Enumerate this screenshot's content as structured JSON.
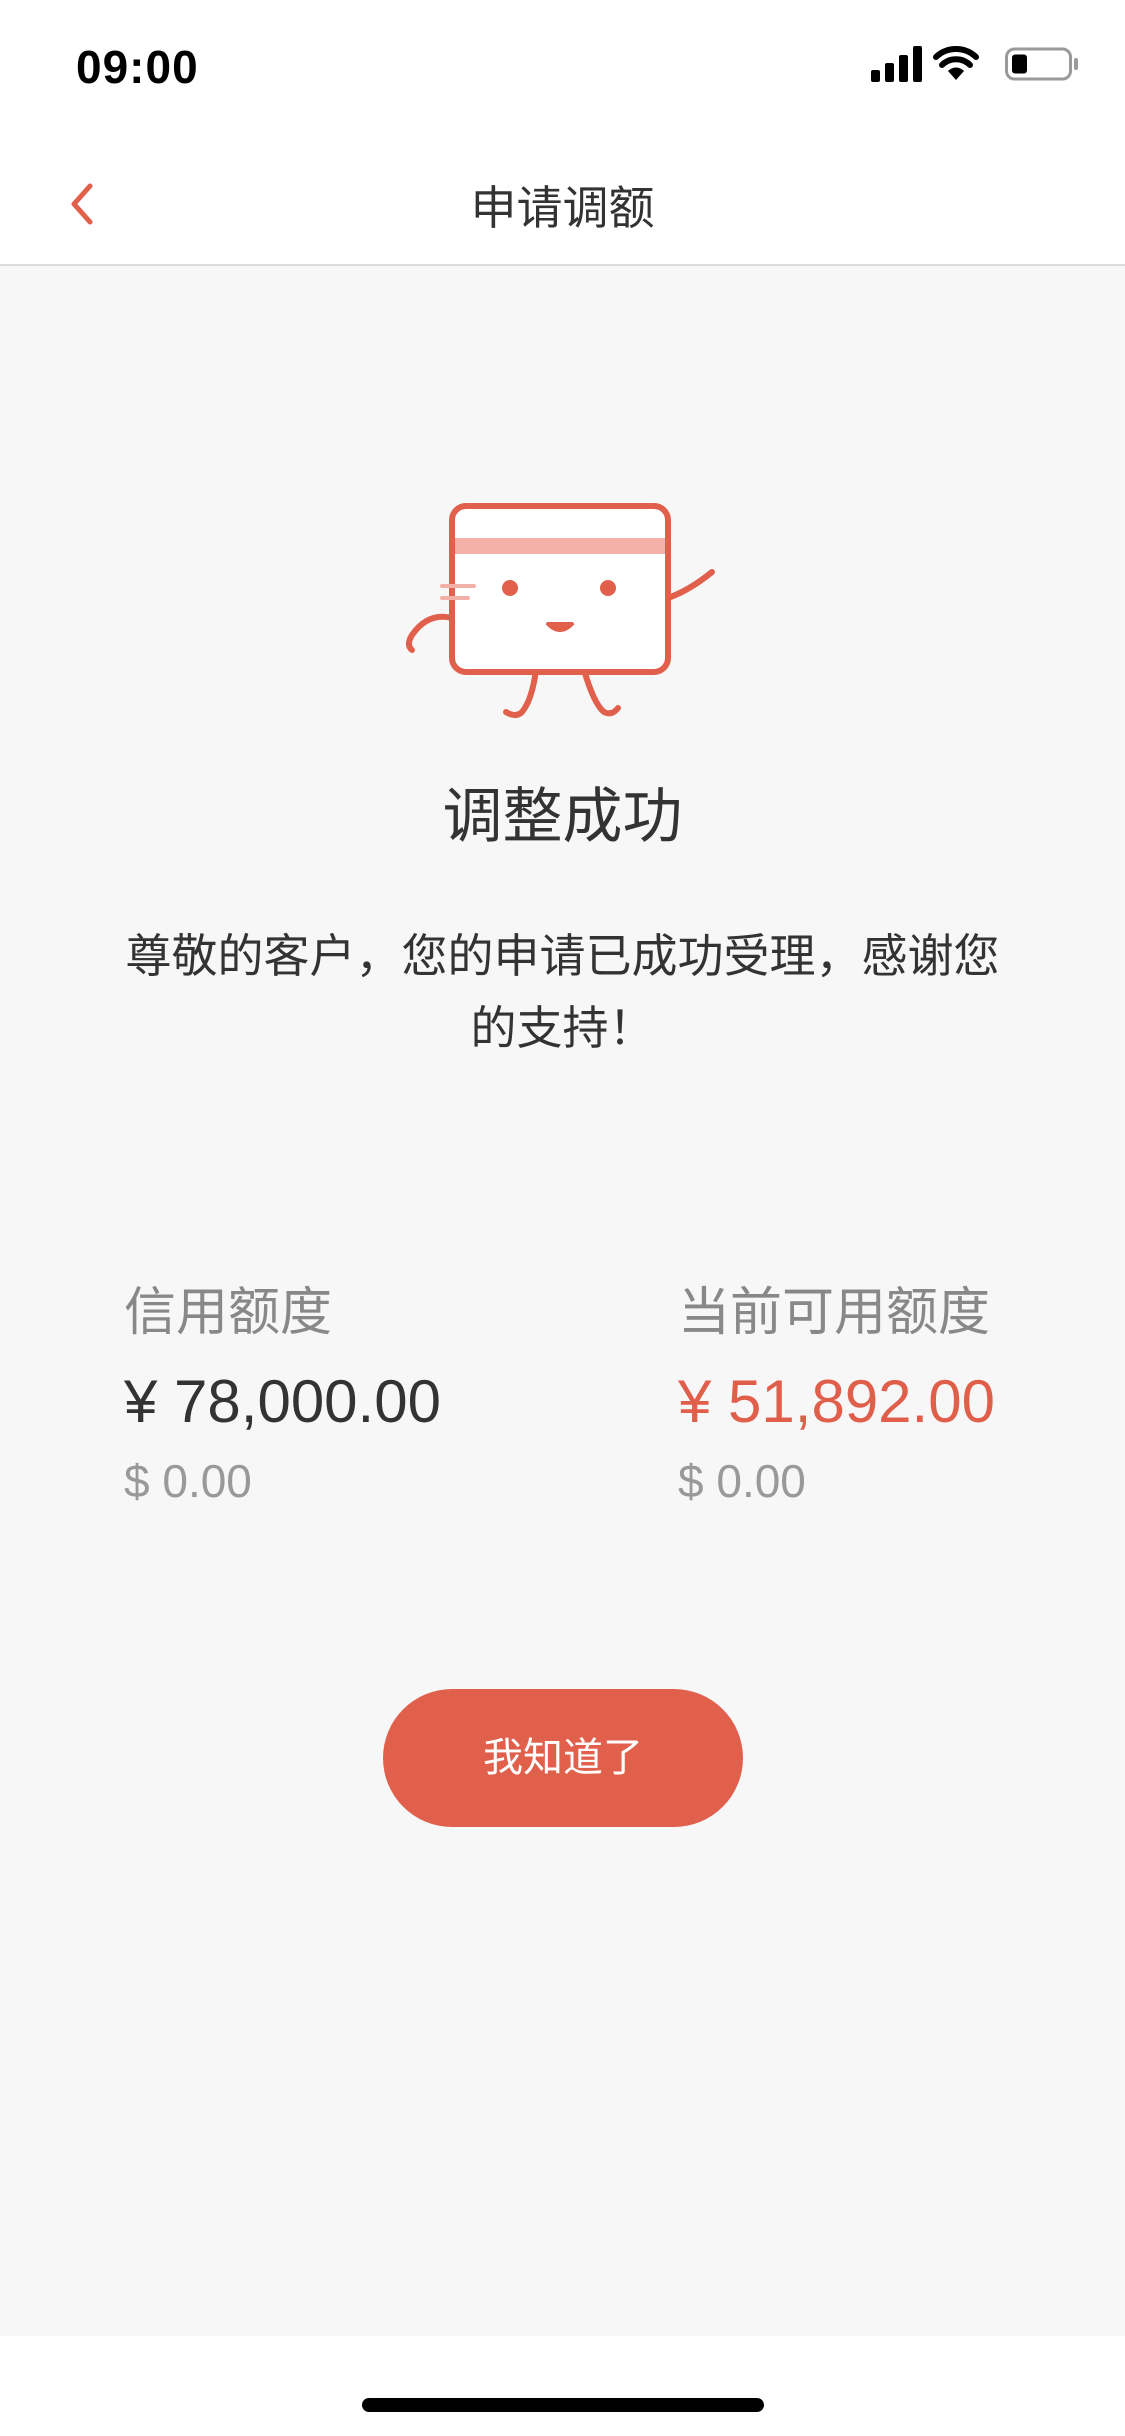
{
  "status_bar": {
    "time": "09:00",
    "icons": [
      "signal-icon",
      "wifi-icon",
      "battery-icon"
    ]
  },
  "nav": {
    "back_icon": "chevron-left-icon",
    "title": "申请调额"
  },
  "result": {
    "illustration": "credit-card-mascot-icon",
    "title": "调整成功",
    "message": "尊敬的客户，您的申请已成功受理，感谢您的支持！"
  },
  "amounts": {
    "credit_limit": {
      "label": "信用额度",
      "cny": "¥ 78,000.00",
      "usd": "$ 0.00"
    },
    "available_limit": {
      "label": "当前可用额度",
      "cny": "¥ 51,892.00",
      "usd": "$ 0.00"
    }
  },
  "confirm_button": {
    "label": "我知道了"
  },
  "colors": {
    "accent": "#e0604c",
    "background": "#f7f7f7",
    "text_primary": "#333333",
    "text_secondary": "#888888"
  }
}
